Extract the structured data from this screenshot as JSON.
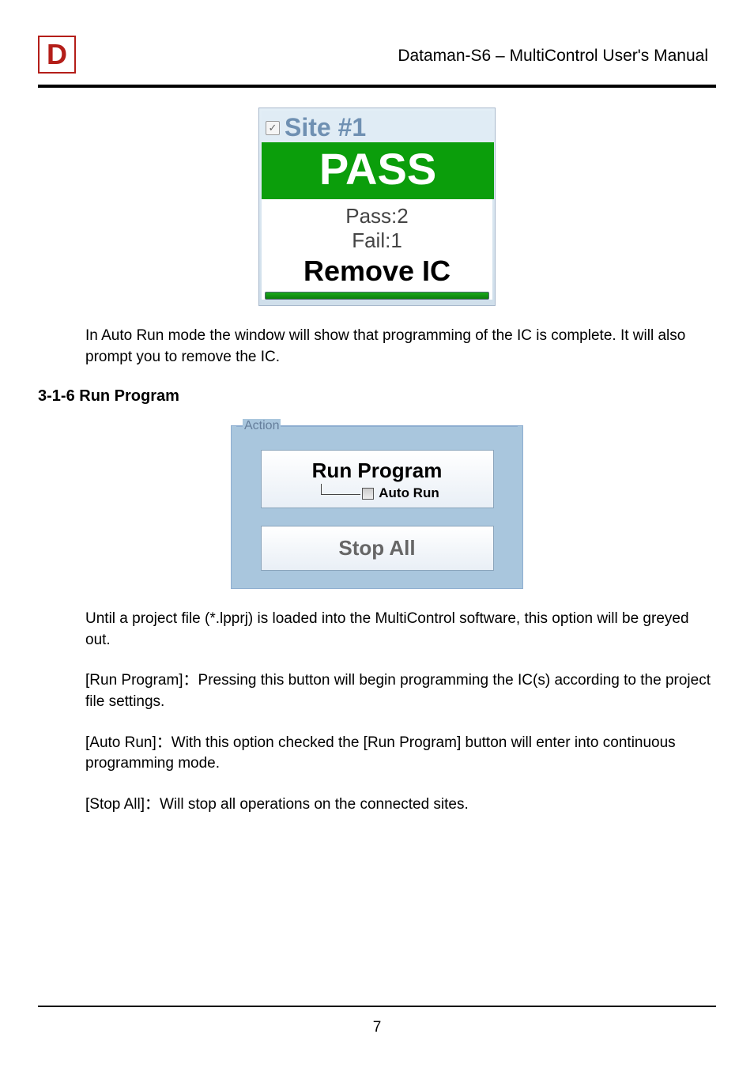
{
  "header": {
    "logo_text": "D",
    "title": "Dataman-S6 – MultiControl User's Manual"
  },
  "site_panel": {
    "checkbox_mark": "✓",
    "title": "Site #1",
    "status": "PASS",
    "pass_label": "Pass:2",
    "fail_label": "Fail:1",
    "action_text": "Remove IC"
  },
  "paragraphs": {
    "p1": "In Auto Run mode the window will show that programming of the IC is complete. It will also prompt you to remove the IC.",
    "p2": "Until a project file (*.lpprj) is loaded into the MultiControl software, this option will be greyed out.",
    "p3": "[Run Program]：Pressing this button will begin programming the IC(s) according to the project file settings.",
    "p4": "[Auto Run]：With this option checked the [Run Program] button will enter into continuous programming mode.",
    "p5": "[Stop All]：Will stop all operations on the connected sites."
  },
  "section_heading": "3-1-6 Run Program",
  "action_panel": {
    "legend": "Action",
    "run_label": "Run Program",
    "auto_run_label": "Auto Run",
    "stop_label": "Stop All"
  },
  "page_number": "7"
}
